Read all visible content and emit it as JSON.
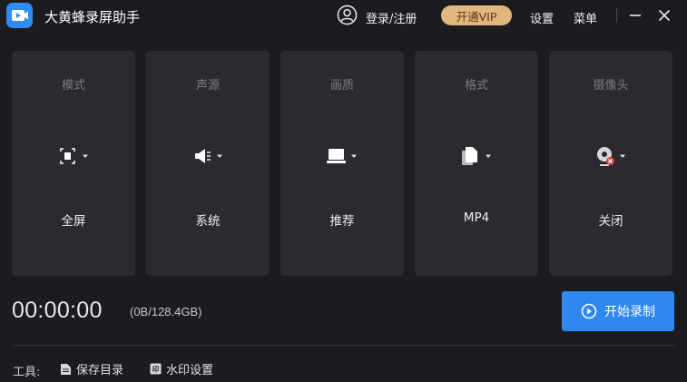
{
  "app": {
    "title": "大黄蜂录屏助手"
  },
  "titlebar": {
    "login_label": "登录/注册",
    "vip_label": "开通VIP",
    "settings_label": "设置",
    "menu_label": "菜单",
    "vip_color": "#e2b67f"
  },
  "cards": [
    {
      "label": "模式",
      "value": "全屏",
      "icon": "fullscreen-icon"
    },
    {
      "label": "声源",
      "value": "系统",
      "icon": "speaker-icon"
    },
    {
      "label": "画质",
      "value": "推荐",
      "icon": "monitor-icon"
    },
    {
      "label": "格式",
      "value": "MP4",
      "icon": "file-icon"
    },
    {
      "label": "摄像头",
      "value": "关闭",
      "icon": "webcam-off-icon"
    }
  ],
  "status": {
    "timer": "00:00:00",
    "storage": "(0B/128.4GB)"
  },
  "record": {
    "label": "开始录制",
    "color": "#2f88f0"
  },
  "tools": {
    "label": "工具:",
    "items": [
      {
        "label": "保存目录",
        "icon": "folder-doc-icon"
      },
      {
        "label": "水印设置",
        "icon": "watermark-icon"
      }
    ]
  }
}
